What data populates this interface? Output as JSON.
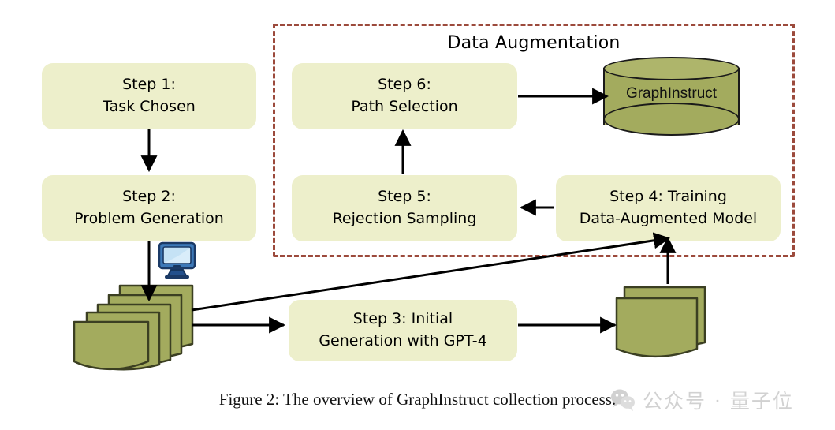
{
  "figure": {
    "caption": "Figure 2: The overview of GraphInstruct collection process."
  },
  "group": {
    "title": "Data Augmentation",
    "border_color": "#9c4a3c",
    "style": "dashed"
  },
  "palette": {
    "box_fill": "#edefcb",
    "doc_fill": "#a3ab5e",
    "doc_stroke": "#3b3f22",
    "cylinder_fill": "#a3ab5e",
    "dashed_border": "#9c4a3c",
    "arrow": "#000000",
    "monitor_blue": "#2c5d9e",
    "monitor_screen": "#bcdcf2"
  },
  "steps": [
    {
      "id": "step1",
      "line1": "Step 1:",
      "line2": "Task Chosen"
    },
    {
      "id": "step2",
      "line1": "Step 2:",
      "line2": "Problem Generation"
    },
    {
      "id": "step3",
      "line1": "Step 3: Initial",
      "line2": "Generation with GPT-4"
    },
    {
      "id": "step4",
      "line1": "Step 4: Training",
      "line2": "Data-Augmented Model"
    },
    {
      "id": "step5",
      "line1": "Step 5:",
      "line2": "Rejection  Sampling"
    },
    {
      "id": "step6",
      "line1": "Step 6:",
      "line2": "Path Selection"
    }
  ],
  "datastore": {
    "label": "GraphInstruct",
    "shape": "cylinder"
  },
  "artifacts": {
    "left_stack": {
      "name": "problem-document-stack",
      "sheets": 5
    },
    "right_stack": {
      "name": "generated-document-stack",
      "sheets": 2
    },
    "monitor": {
      "name": "computer-monitor-icon"
    }
  },
  "flow": [
    {
      "from": "step1",
      "to": "step2",
      "direction": "down"
    },
    {
      "from": "step2",
      "to": "left_stack",
      "direction": "down"
    },
    {
      "from": "left_stack",
      "to": "step3",
      "direction": "right"
    },
    {
      "from": "left_stack",
      "to": "step4",
      "direction": "diagonal-up-right"
    },
    {
      "from": "step3",
      "to": "right_stack",
      "direction": "right"
    },
    {
      "from": "right_stack",
      "to": "step4",
      "direction": "up"
    },
    {
      "from": "step4",
      "to": "step5",
      "direction": "left"
    },
    {
      "from": "step5",
      "to": "step6",
      "direction": "up"
    },
    {
      "from": "step6",
      "to": "datastore",
      "direction": "right"
    }
  ],
  "watermark": {
    "text": "公众号 · 量子位",
    "icon": "wechat-logo-icon"
  }
}
